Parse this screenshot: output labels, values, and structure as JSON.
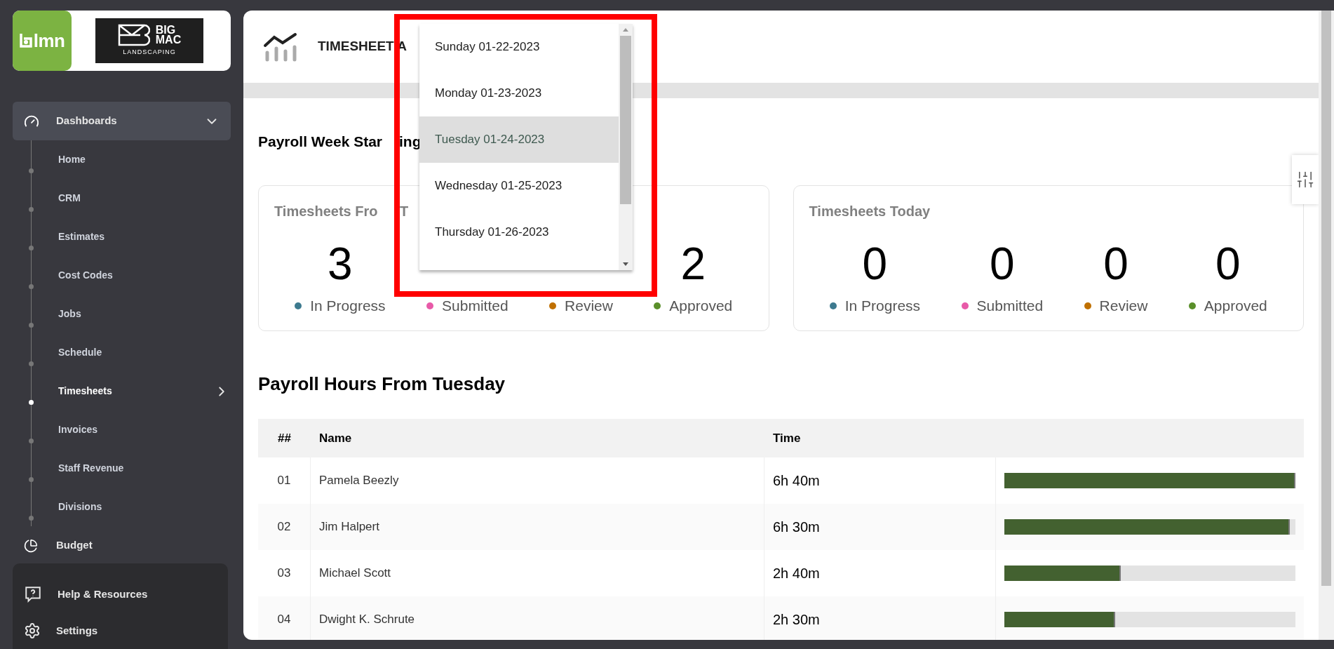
{
  "sidebar": {
    "logo": {
      "text": "lmn"
    },
    "client_logo": {
      "lines": [
        "BIG",
        "MAC",
        "LANDSCAPING"
      ]
    },
    "nav": [
      {
        "label": "Dashboards",
        "kind": "group",
        "expanded": true,
        "children": [
          {
            "label": "Home",
            "selected": false
          },
          {
            "label": "CRM",
            "selected": false
          },
          {
            "label": "Estimates",
            "selected": false
          },
          {
            "label": "Cost Codes",
            "selected": false
          },
          {
            "label": "Jobs",
            "selected": false
          },
          {
            "label": "Schedule",
            "selected": false
          },
          {
            "label": "Timesheets",
            "selected": true,
            "has_submenu": true
          },
          {
            "label": "Invoices",
            "selected": false
          },
          {
            "label": "Staff Revenue",
            "selected": false
          },
          {
            "label": "Divisions",
            "selected": false
          }
        ]
      },
      {
        "label": "Budget",
        "kind": "item"
      }
    ],
    "footer": [
      {
        "label": "Help & Resources",
        "kind": "help"
      },
      {
        "label": "Settings",
        "kind": "settings"
      }
    ]
  },
  "header": {
    "title": "TIMESHEET A"
  },
  "week": {
    "label_parts": [
      "Payroll Week Star",
      "ing"
    ],
    "options": [
      {
        "label": "Sunday 01-22-2023",
        "selected": false
      },
      {
        "label": "Monday 01-23-2023",
        "selected": false
      },
      {
        "label": "Tuesday 01-24-2023",
        "selected": true
      },
      {
        "label": "Wednesday 01-25-2023",
        "selected": false
      },
      {
        "label": "Thursday 01-26-2023",
        "selected": false
      }
    ]
  },
  "cards": [
    {
      "title_parts": [
        "Timesheets Fro",
        "T"
      ],
      "stats": [
        {
          "value": "3",
          "label": "In Progress",
          "color": "#3d7a8f"
        },
        {
          "label": "Submitted",
          "color": "#e85aa8"
        },
        {
          "label": "Review",
          "color": "#c07000"
        },
        {
          "value": "2",
          "label": "Approved",
          "color": "#5a8f2a"
        }
      ]
    },
    {
      "title_parts": [
        "Timesheets Today"
      ],
      "stats": [
        {
          "value": "0",
          "label": "In Progress",
          "color": "#3d7a8f"
        },
        {
          "value": "0",
          "label": "Submitted",
          "color": "#e85aa8"
        },
        {
          "value": "0",
          "label": "Review",
          "color": "#c07000"
        },
        {
          "value": "0",
          "label": "Approved",
          "color": "#5a8f2a"
        }
      ]
    }
  ],
  "hours": {
    "title": "Payroll Hours From Tuesday",
    "columns": [
      "##",
      "Name",
      "Time"
    ],
    "rows": [
      {
        "number": "01",
        "name": "Pamela Beezly",
        "time": "6h 40m",
        "level": 1.0
      },
      {
        "number": "02",
        "name": "Jim Halpert",
        "time": "6h 30m",
        "level": 0.98
      },
      {
        "number": "03",
        "name": "Michael Scott",
        "time": "2h 40m",
        "level": 0.4
      },
      {
        "number": "04",
        "name": "Dwight K. Schrute",
        "time": "2h 30m",
        "level": 0.38
      }
    ]
  }
}
